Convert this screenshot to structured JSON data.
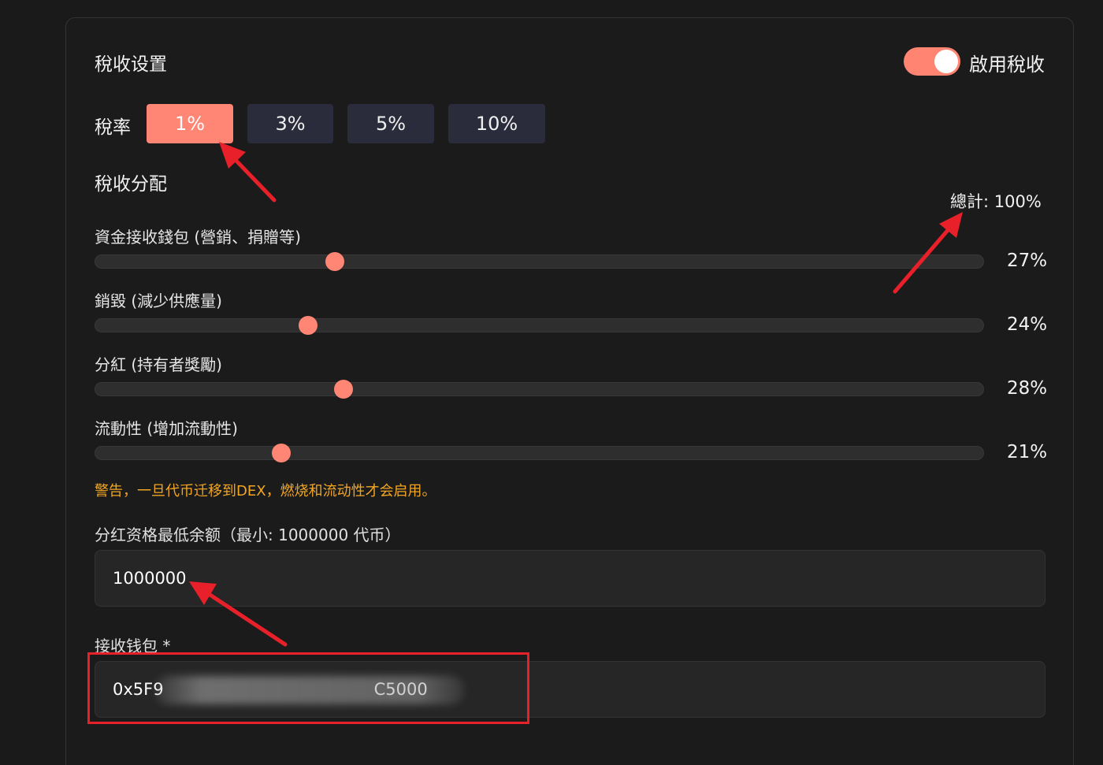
{
  "header": {
    "title": "稅收设置",
    "toggle": {
      "label": "啟用稅收",
      "enabled": true
    }
  },
  "tax_rate": {
    "label": "稅率",
    "options": [
      "1%",
      "3%",
      "5%",
      "10%"
    ],
    "selected": "1%"
  },
  "distribution": {
    "title": "稅收分配",
    "total_label": "總計: 100%",
    "items": [
      {
        "label": "資金接收錢包 (營銷、捐贈等)",
        "value": 27,
        "display": "27%"
      },
      {
        "label": "銷毀 (減少供應量)",
        "value": 24,
        "display": "24%"
      },
      {
        "label": "分紅 (持有者獎勵)",
        "value": 28,
        "display": "28%"
      },
      {
        "label": "流動性 (增加流動性)",
        "value": 21,
        "display": "21%"
      }
    ]
  },
  "warning": "警告，一旦代币迁移到DEX，燃烧和流动性才会启用。",
  "min_balance": {
    "label": "分红资格最低余额（最小: 1000000 代币）",
    "value": "1000000"
  },
  "wallet": {
    "label": "接收钱包 *",
    "value": "0x5F9                                        C5000"
  },
  "colors": {
    "accent": "#ff8674",
    "warning": "#f2a623",
    "annotation": "#e8202a"
  }
}
